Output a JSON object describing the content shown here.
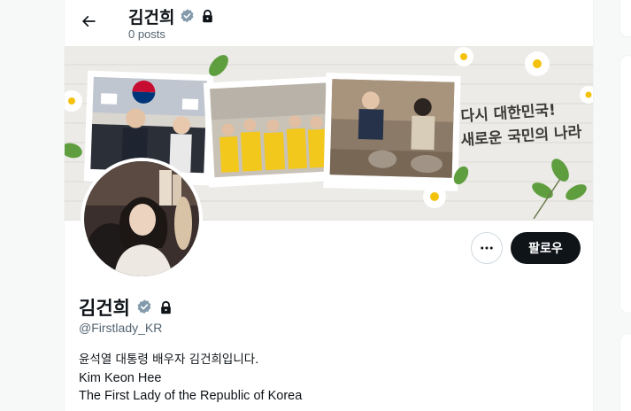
{
  "header": {
    "display_name": "김건희",
    "post_count": "0 posts"
  },
  "banner": {
    "slogan_line1": "다시 대한민국!",
    "slogan_line2": "새로운 국민의 나라"
  },
  "actions": {
    "follow_label": "팔로우"
  },
  "profile": {
    "display_name": "김건희",
    "handle": "@Firstlady_KR",
    "bio": [
      "윤석열 대통령 배우자 김건희입니다.",
      "Kim Keon Hee",
      "The First Lady of the Republic of Korea"
    ]
  },
  "colors": {
    "verified_badge": "#829aab",
    "follow_button_bg": "#0f1419",
    "secondary_text": "#536471",
    "divider": "#eff3f4"
  },
  "icons": [
    "back-arrow-icon",
    "verified-badge-icon",
    "lock-icon",
    "more-icon"
  ]
}
